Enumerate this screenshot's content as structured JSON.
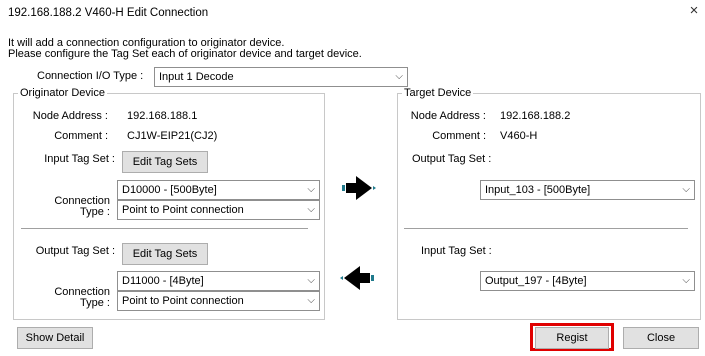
{
  "window": {
    "title": "192.168.188.2 V460-H Edit Connection",
    "close_glyph": "×"
  },
  "intro": {
    "line1": "It will add a connection configuration to originator device.",
    "line2": "Please configure the Tag Set each of originator device and target device."
  },
  "connection_io_type": {
    "label": "Connection I/O Type :",
    "value": "Input 1 Decode"
  },
  "originator": {
    "legend": "Originator Device",
    "node_address_label": "Node Address :",
    "node_address": "192.168.188.1",
    "comment_label": "Comment :",
    "comment": "CJ1W-EIP21(CJ2)",
    "input_tag_set_label": "Input Tag Set :",
    "input_edit_button": "Edit Tag Sets",
    "input_tag_value": "D10000 - [500Byte]",
    "connection_type_label_1": "Connection",
    "connection_type_label_2": "Type :",
    "input_connection_type": "Point to Point connection",
    "output_tag_set_label": "Output Tag Set :",
    "output_edit_button": "Edit Tag Sets",
    "output_tag_value": "D11000 - [4Byte]",
    "output_connection_type": "Point to Point connection"
  },
  "target": {
    "legend": "Target Device",
    "node_address_label": "Node Address :",
    "node_address": "192.168.188.2",
    "comment_label": "Comment :",
    "comment": "V460-H",
    "output_tag_set_label": "Output Tag Set :",
    "output_tag_value": "Input_103 - [500Byte]",
    "input_tag_set_label": "Input Tag Set :",
    "input_tag_value": "Output_197 - [4Byte]"
  },
  "buttons": {
    "show_detail": "Show Detail",
    "regist": "Regist",
    "close": "Close"
  },
  "colors": {
    "highlight": "#e00000",
    "arrow_body": "#000000",
    "arrow_dither": "#1f7a8c"
  },
  "icons": {
    "dropdown": "chevron-down-icon",
    "arrow_right": "arrow-right-icon",
    "arrow_left": "arrow-left-icon"
  }
}
